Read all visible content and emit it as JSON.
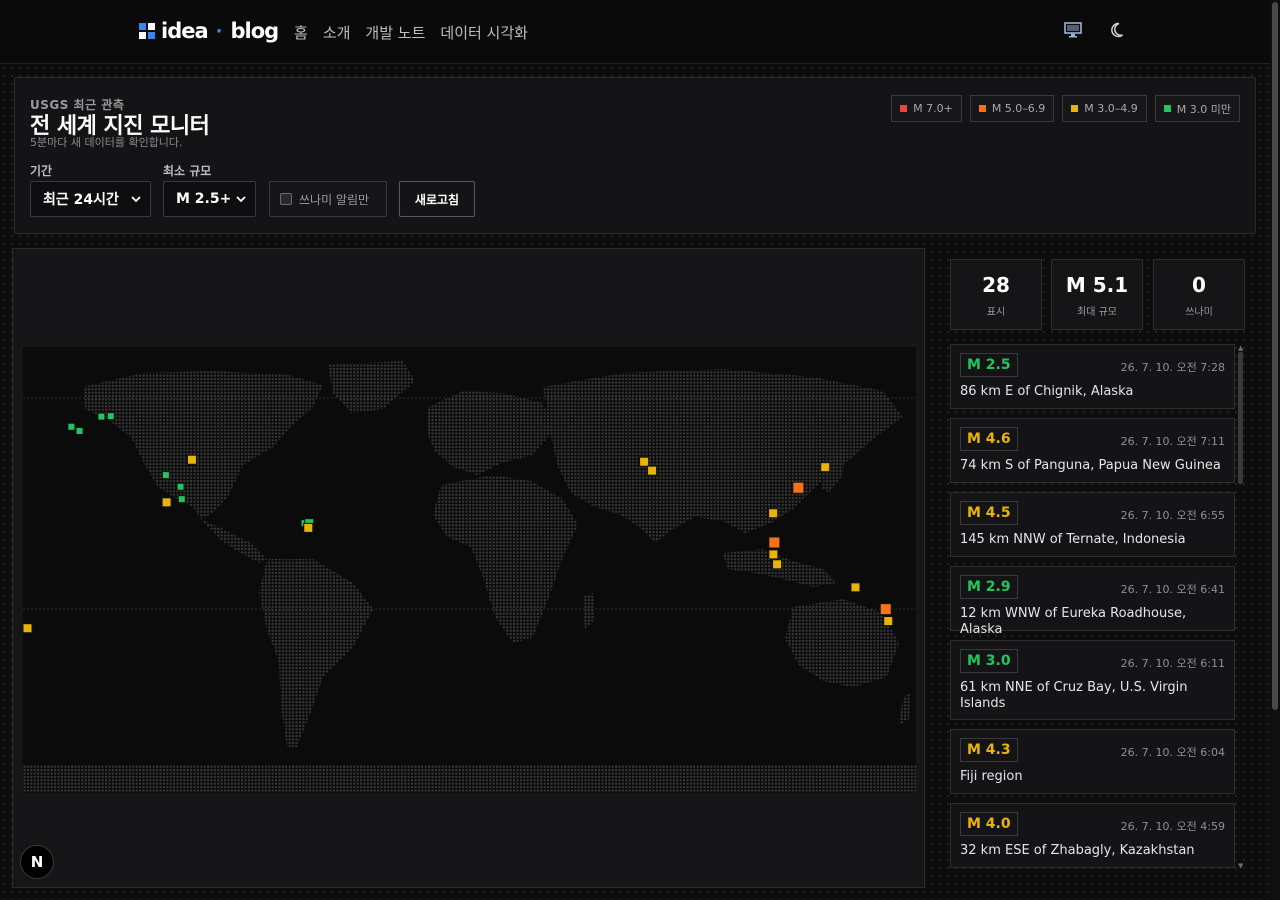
{
  "brand": {
    "name_left": "idea",
    "separator": "·",
    "name_right": "blog",
    "logo_colors": [
      "#3b82f6",
      "#ffffff",
      "#ffffff",
      "#3b82f6"
    ]
  },
  "nav": {
    "items": [
      "홈",
      "소개",
      "개발 노트",
      "데이터 시각화"
    ]
  },
  "topbar_icons": [
    "monitor-icon",
    "moon-icon"
  ],
  "panel": {
    "eyebrow": "USGS 최근 관측",
    "title": "전 세계 지진 모니터",
    "subtitle": "5분마다 새 데이터를 확인합니다.",
    "legend": [
      {
        "label": "M 7.0+",
        "color": "#ef4444"
      },
      {
        "label": "M 5.0–6.9",
        "color": "#f97316"
      },
      {
        "label": "M 3.0–4.9",
        "color": "#eab308"
      },
      {
        "label": "M 3.0 미만",
        "color": "#22c55e"
      }
    ],
    "period_label": "기간",
    "period_value": "최근 24시간",
    "min_mag_label": "최소 규모",
    "min_mag_value": "M 2.5+",
    "tsunami_label": "쓰나미 알림만",
    "tsunami_checked": false,
    "refresh_label": "새로고침"
  },
  "stats": [
    {
      "value": "28",
      "label": "표시"
    },
    {
      "value": "M 5.1",
      "label": "최대 규모"
    },
    {
      "value": "0",
      "label": "쓰나미"
    }
  ],
  "quakes": [
    {
      "mag": "M 2.5",
      "color": "#22c55e",
      "time": "26. 7. 10. 오전 7:28",
      "place": "86 km E of Chignik, Alaska"
    },
    {
      "mag": "M 4.6",
      "color": "#eab308",
      "time": "26. 7. 10. 오전 7:11",
      "place": "74 km S of Panguna, Papua New Guinea"
    },
    {
      "mag": "M 4.5",
      "color": "#eab308",
      "time": "26. 7. 10. 오전 6:55",
      "place": "145 km NNW of Ternate, Indonesia"
    },
    {
      "mag": "M 2.9",
      "color": "#22c55e",
      "time": "26. 7. 10. 오전 6:41",
      "place": "12 km WNW of Eureka Roadhouse, Alaska"
    },
    {
      "mag": "M 3.0",
      "color": "#22c55e",
      "time": "26. 7. 10. 오전 6:11",
      "place": "61 km NNE of Cruz Bay, U.S. Virgin Islands"
    },
    {
      "mag": "M 4.3",
      "color": "#eab308",
      "time": "26. 7. 10. 오전 6:04",
      "place": "Fiji region"
    },
    {
      "mag": "M 4.0",
      "color": "#eab308",
      "time": "26. 7. 10. 오전 4:59",
      "place": "32 km ESE of Zhabagly, Kazakhstan"
    }
  ],
  "map_markers": [
    {
      "lon": -160.5,
      "lat": 57.8,
      "mag": 2.6,
      "color": "#22c55e"
    },
    {
      "lon": -157.2,
      "lat": 56.1,
      "mag": 2.5,
      "color": "#22c55e"
    },
    {
      "lon": -148.4,
      "lat": 61.9,
      "mag": 2.9,
      "color": "#22c55e"
    },
    {
      "lon": -144.6,
      "lat": 62.1,
      "mag": 2.7,
      "color": "#22c55e"
    },
    {
      "lon": -122.4,
      "lat": 38.3,
      "mag": 2.6,
      "color": "#22c55e"
    },
    {
      "lon": -122.1,
      "lat": 27.3,
      "mag": 3.4,
      "color": "#eab308"
    },
    {
      "lon": -116.5,
      "lat": 33.6,
      "mag": 2.7,
      "color": "#22c55e"
    },
    {
      "lon": -116.0,
      "lat": 28.6,
      "mag": 2.8,
      "color": "#22c55e"
    },
    {
      "lon": -111.9,
      "lat": 44.5,
      "mag": 3.1,
      "color": "#eab308"
    },
    {
      "lon": -66.5,
      "lat": 18.9,
      "mag": 2.8,
      "color": "#22c55e"
    },
    {
      "lon": -64.6,
      "lat": 18.9,
      "mag": 3.0,
      "color": "#22c55e"
    },
    {
      "lon": -65.0,
      "lat": 17.0,
      "mag": 3.5,
      "color": "#eab308"
    },
    {
      "lon": -179.0,
      "lat": -23.5,
      "mag": 3.2,
      "color": "#eab308"
    },
    {
      "lon": 70.4,
      "lat": 43.7,
      "mag": 4.0,
      "color": "#eab308"
    },
    {
      "lon": 73.6,
      "lat": 40.1,
      "mag": 3.8,
      "color": "#eab308"
    },
    {
      "lon": 143.4,
      "lat": 41.5,
      "mag": 4.1,
      "color": "#eab308"
    },
    {
      "lon": 132.6,
      "lat": 33.2,
      "mag": 5.1,
      "color": "#f97316"
    },
    {
      "lon": 122.4,
      "lat": 22.9,
      "mag": 4.2,
      "color": "#eab308"
    },
    {
      "lon": 122.9,
      "lat": 11.1,
      "mag": 5.0,
      "color": "#f97316"
    },
    {
      "lon": 122.5,
      "lat": 6.3,
      "mag": 3.9,
      "color": "#eab308"
    },
    {
      "lon": 124.0,
      "lat": 2.3,
      "mag": 4.5,
      "color": "#eab308"
    },
    {
      "lon": 155.6,
      "lat": -7.0,
      "mag": 4.6,
      "color": "#eab308"
    },
    {
      "lon": 167.8,
      "lat": -15.8,
      "mag": 5.0,
      "color": "#f97316"
    },
    {
      "lon": 168.8,
      "lat": -20.6,
      "mag": 4.3,
      "color": "#eab308"
    }
  ]
}
